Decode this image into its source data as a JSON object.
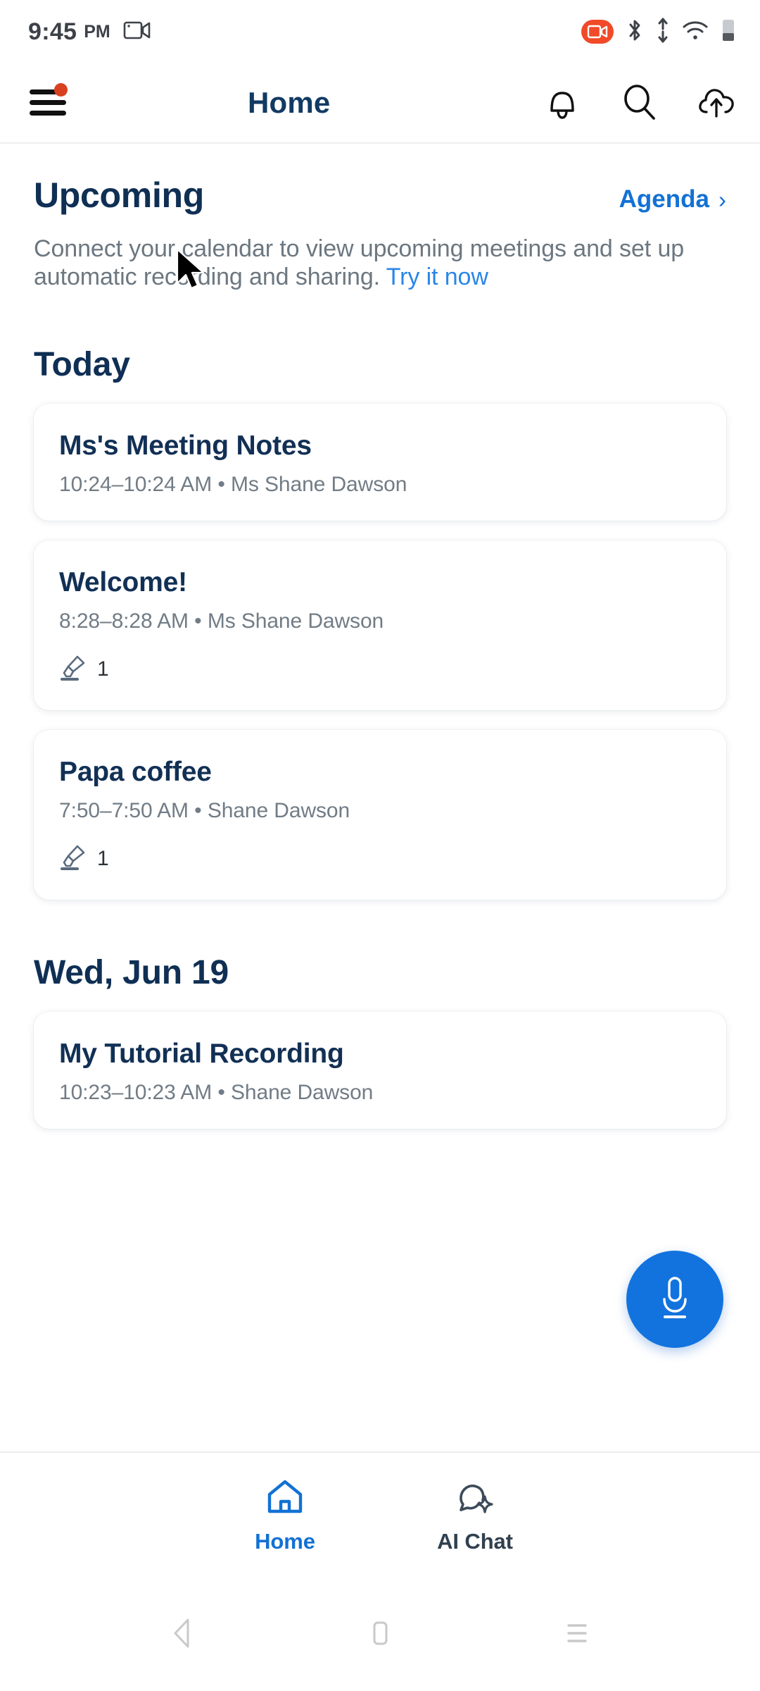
{
  "status_bar": {
    "time": "9:45",
    "ampm": "PM",
    "icons": [
      "video-camera-icon",
      "screen-record-badge-icon",
      "bluetooth-icon",
      "data-transfer-icon",
      "wifi-icon",
      "battery-icon"
    ]
  },
  "app_bar": {
    "menu_icon": "hamburger-menu-icon",
    "menu_badge": "notification-dot",
    "title": "Home",
    "actions": [
      "bell-icon",
      "search-icon",
      "cloud-upload-icon"
    ]
  },
  "upcoming": {
    "heading": "Upcoming",
    "agenda_label": "Agenda",
    "agenda_chevron": "›",
    "blurb_before": "Connect your calendar to view upcoming meetings and set up automatic recording and sharing. ",
    "blurb_link": "Try it now"
  },
  "sections": [
    {
      "heading": "Today",
      "cards": [
        {
          "title": "Ms's Meeting Notes",
          "subtitle": "10:24–10:24 AM  •  Ms Shane Dawson",
          "highlight_count": null
        },
        {
          "title": "Welcome!",
          "subtitle": "8:28–8:28 AM  •  Ms Shane Dawson",
          "highlight_count": "1"
        },
        {
          "title": "Papa coffee",
          "subtitle": "7:50–7:50 AM  •  Shane Dawson",
          "highlight_count": "1"
        }
      ]
    },
    {
      "heading": "Wed, Jun 19",
      "cards": [
        {
          "title": "My Tutorial Recording",
          "subtitle": "10:23–10:23 AM  •  Shane Dawson",
          "highlight_count": null
        }
      ]
    }
  ],
  "fab": {
    "icon": "microphone-icon"
  },
  "bottom_nav": [
    {
      "label": "Home",
      "icon": "home-icon",
      "active": true
    },
    {
      "label": "AI Chat",
      "icon": "ai-chat-bubble-icon",
      "active": false
    }
  ],
  "system_nav": [
    "back-triangle-icon",
    "home-square-icon",
    "recents-lines-icon"
  ],
  "colors": {
    "accent_blue": "#1271d4",
    "fab_blue": "#1273df",
    "title_navy": "#123055",
    "heading_navy": "#0f2f54",
    "muted_text": "#6c7780",
    "badge_red": "#d8411f",
    "record_red": "#f04a28"
  }
}
